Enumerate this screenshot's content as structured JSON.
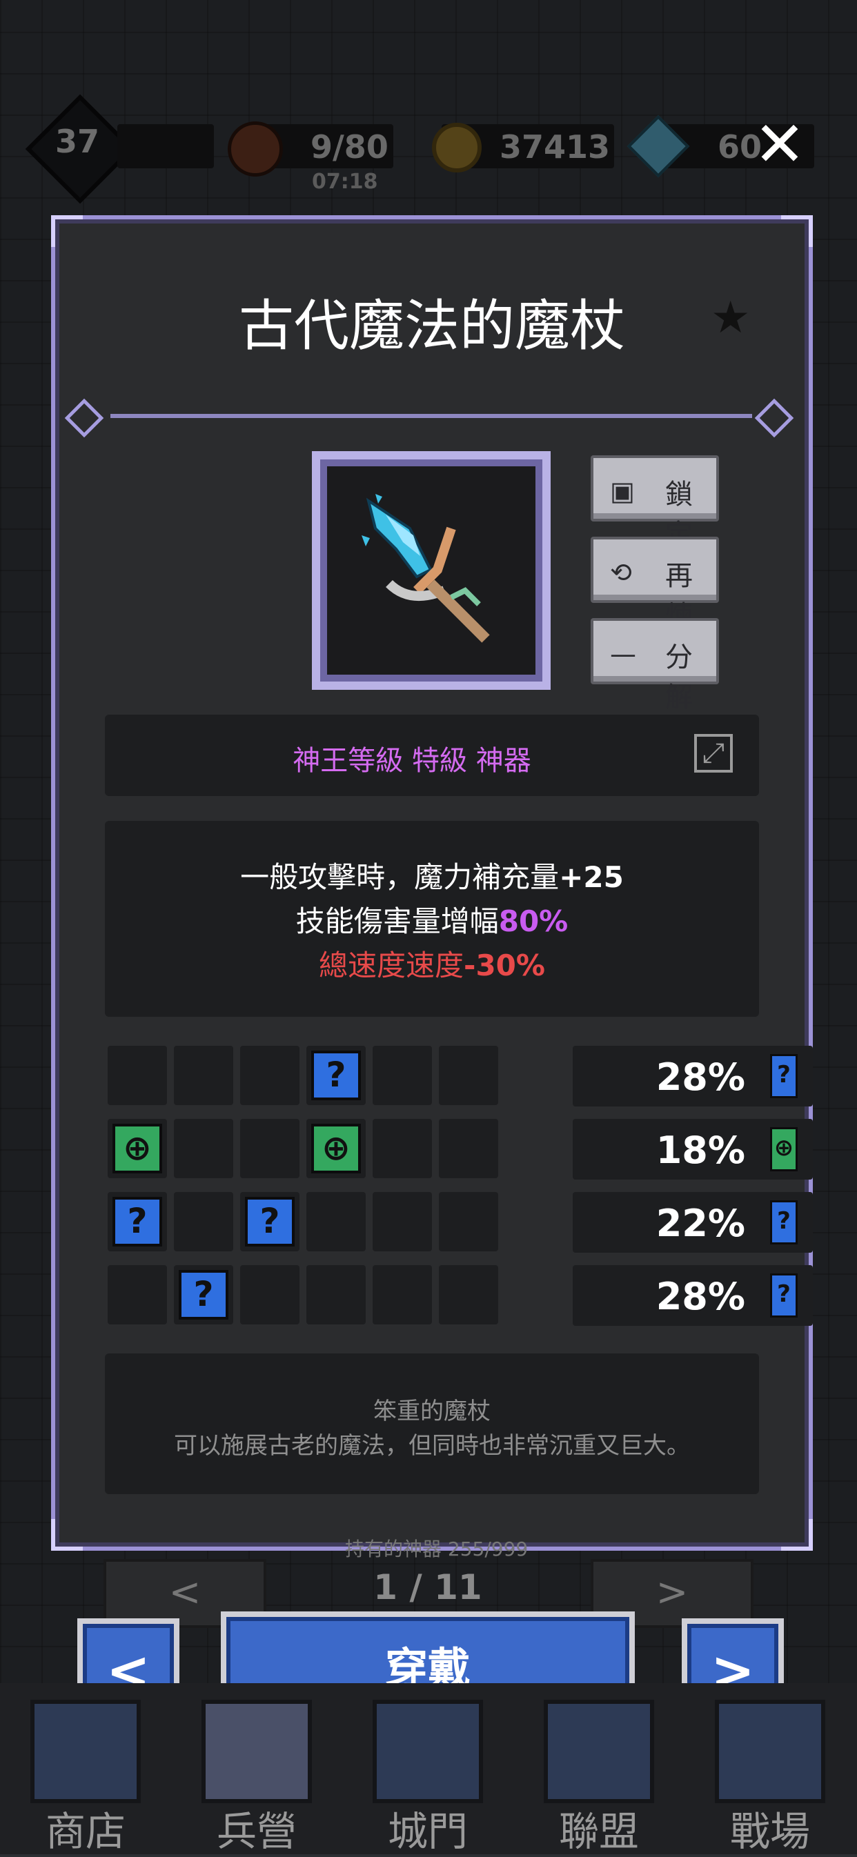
{
  "status": {
    "level": "37",
    "meat": "9/80",
    "timer": "07:18",
    "gold": "37413",
    "gems": "60"
  },
  "item": {
    "name": "古代魔法的魔杖",
    "grade": "神王等級 特級 神器",
    "actions": [
      {
        "label": "鎖定",
        "icon": "lock-icon"
      },
      {
        "label": "再煉",
        "icon": "refine-icon"
      },
      {
        "label": "分解",
        "icon": "minus-icon"
      }
    ],
    "effects": {
      "line1_text": "一般攻擊時，魔力補充量",
      "line1_value": "+25",
      "line2_text": "技能傷害量增幅",
      "line2_value": "80%",
      "line3_text": "總速度速度",
      "line3_value": "-30%"
    },
    "rune_rows": [
      {
        "slots": [
          "",
          "",
          "",
          "blue",
          "",
          ""
        ],
        "percent": "28%",
        "flag": "blue"
      },
      {
        "slots": [
          "green",
          "",
          "",
          "green",
          "",
          ""
        ],
        "percent": "18%",
        "flag": "green"
      },
      {
        "slots": [
          "blue",
          "",
          "blue",
          "",
          "",
          ""
        ],
        "percent": "22%",
        "flag": "blue"
      },
      {
        "slots": [
          "",
          "blue",
          "",
          "",
          "",
          ""
        ],
        "percent": "28%",
        "flag": "blue"
      }
    ],
    "description": {
      "line1": "笨重的魔杖",
      "line2": "可以施展古老的魔法，但同時也非常沉重又巨大。"
    }
  },
  "pager": {
    "owned": "持有的神器 255/999",
    "prev": "<",
    "next": ">",
    "page": "1 / 11"
  },
  "footer": {
    "prev": "<",
    "equip": "穿戴",
    "next": ">"
  },
  "nav": [
    {
      "label": "商店"
    },
    {
      "label": "兵營"
    },
    {
      "label": "城門"
    },
    {
      "label": "聯盟"
    },
    {
      "label": "戰場"
    }
  ],
  "colors": {
    "grade": "#d46bf0",
    "value_white": "#ffffff",
    "value_purple": "#c95cf0",
    "penalty_red": "#e84a4a",
    "gem_blue": "#2f6fe0",
    "gem_green": "#34a85f"
  }
}
